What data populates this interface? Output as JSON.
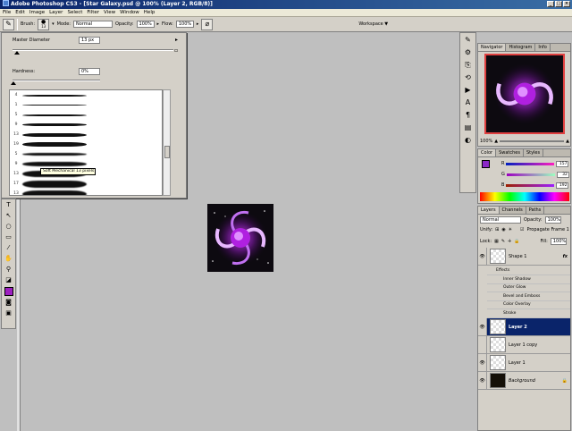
{
  "window": {
    "title": "Adobe Photoshop CS3 - [Star Galaxy.psd @ 100% (Layer 2, RGB/8)]"
  },
  "menu": [
    "File",
    "Edit",
    "Image",
    "Layer",
    "Select",
    "Filter",
    "View",
    "Window",
    "Help"
  ],
  "options": {
    "brush_label": "Brush:",
    "brush_size": "13",
    "mode_label": "Mode:",
    "mode_value": "Normal",
    "opacity_label": "Opacity:",
    "opacity_value": "100%",
    "flow_label": "Flow:",
    "flow_value": "100%",
    "workspace_label": "Workspace ▼"
  },
  "brush_picker": {
    "master_diameter_label": "Master Diameter",
    "master_diameter_value": "13 px",
    "hardness_label": "Hardness:",
    "hardness_value": "0%",
    "brushes": [
      {
        "size": "4",
        "thick": 2
      },
      {
        "size": "1",
        "thick": 1
      },
      {
        "size": "5",
        "thick": 2
      },
      {
        "size": "9",
        "thick": 3
      },
      {
        "size": "13",
        "thick": 4
      },
      {
        "size": "19",
        "thick": 5
      },
      {
        "size": "5",
        "thick": 3
      },
      {
        "size": "9",
        "thick": 5
      },
      {
        "size": "13",
        "thick": 7
      },
      {
        "size": "17",
        "thick": 8
      },
      {
        "size": "13",
        "thick": 8
      },
      {
        "size": "14",
        "thick": 6
      },
      {
        "size": "14",
        "thick": 7
      },
      {
        "size": "14",
        "thick": 8
      }
    ],
    "tooltip": "Soft Mechanical 13 pixels"
  },
  "navigator": {
    "tabs": [
      "Navigator",
      "Histogram",
      "Info"
    ],
    "zoom": "100%"
  },
  "color": {
    "tabs": [
      "Color",
      "Swatches",
      "Styles"
    ],
    "r": "157",
    "g": "32",
    "b": "192",
    "fg": "#9d20c0"
  },
  "layers": {
    "tabs": [
      "Layers",
      "Channels",
      "Paths"
    ],
    "blend_mode": "Normal",
    "opacity_label": "Opacity:",
    "opacity": "100%",
    "unify_label": "Unify:",
    "propagate_label": "Propagate Frame 1",
    "lock_label": "Lock:",
    "fill_label": "Fill:",
    "fill": "100%",
    "items": [
      {
        "name": "Shape 1",
        "fx": "fx"
      },
      {
        "name": "Layer 2"
      },
      {
        "name": "Layer 1 copy"
      },
      {
        "name": "Layer 1"
      },
      {
        "name": "Background"
      }
    ],
    "effects_label": "Effects",
    "effects": [
      "Inner Shadow",
      "Outer Glow",
      "Bevel and Emboss",
      "Color Overlay",
      "Stroke"
    ]
  }
}
